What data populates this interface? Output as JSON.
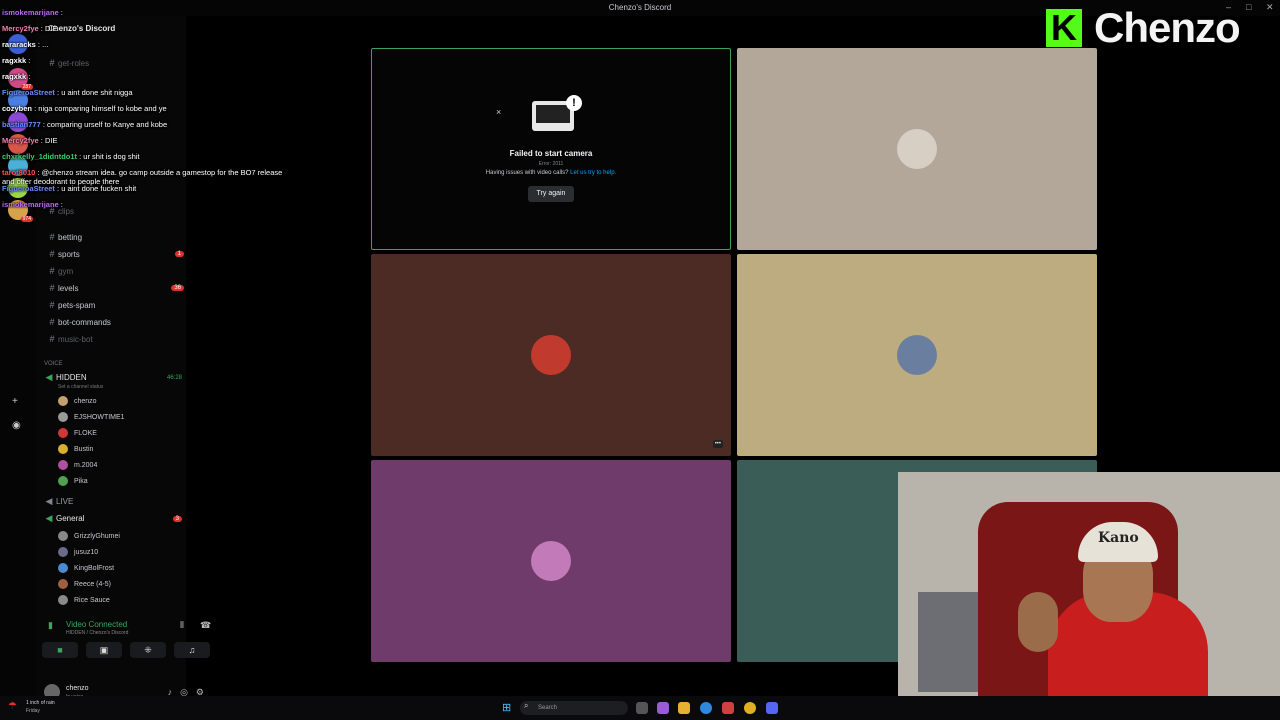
{
  "window": {
    "title": "Chenzo's Discord"
  },
  "brand": {
    "logo_letter": "K",
    "name": "Chenzo",
    "accent": "#53fc18"
  },
  "chat": [
    {
      "user": "ismokemarijane",
      "color": "#b86cf0",
      "text": ""
    },
    {
      "user": "Mercy2fye",
      "color": "#f47fb0",
      "text": "DIE"
    },
    {
      "user": "rararacks",
      "color": "#ffffff",
      "text": "..."
    },
    {
      "user": "ragxkk",
      "color": "#ffffff",
      "text": ""
    },
    {
      "user": "ragxkk",
      "color": "#ffffff",
      "text": ""
    },
    {
      "user": "FigueroaStreet",
      "color": "#6c8cff",
      "text": "u aint done shit nigga"
    },
    {
      "user": "cozyben",
      "color": "#ffffff",
      "text": "niga comparing himself to kobe and ye"
    },
    {
      "user": "bastian777",
      "color": "#6c8cff",
      "text": "comparing urself to Kanye and kobe"
    },
    {
      "user": "Mercy2fye",
      "color": "#f47fb0",
      "text": "DIE"
    },
    {
      "user": "chxrkelly_1didntdo1t",
      "color": "#3ccf6e",
      "text": "ur shit is dog shit"
    },
    {
      "user": "tarot8010",
      "color": "#ff5050",
      "text": "@chenzo stream idea. go camp outside a gamestop for the BO7 release and offer deodorant to people there"
    },
    {
      "user": "FigueroaStreet",
      "color": "#6c8cff",
      "text": "u aint done fucken shit"
    },
    {
      "user": "ismokemarijane",
      "color": "#b86cf0",
      "text": ""
    }
  ],
  "rail": {
    "servers": [
      {
        "color": "#3b5fd6",
        "badge": ""
      },
      {
        "color": "#d04a8a",
        "badge": "287"
      },
      {
        "color": "#4a7fe0",
        "badge": ""
      },
      {
        "color": "#8a4ad6",
        "badge": ""
      },
      {
        "color": "#d6574a",
        "badge": ""
      },
      {
        "color": "#4ab0d6",
        "badge": ""
      },
      {
        "color": "#9ad64a",
        "badge": ""
      },
      {
        "color": "#d6a24a",
        "badge": "974"
      }
    ]
  },
  "sidebar": {
    "server_name": "Chenzo's Discord",
    "channels_top": [
      {
        "name": "get-roles",
        "muted": true,
        "count": ""
      },
      {
        "name": "clips",
        "muted": true,
        "count": ""
      },
      {
        "name": "betting",
        "muted": false,
        "count": ""
      },
      {
        "name": "sports",
        "muted": false,
        "count": "1"
      },
      {
        "name": "gym",
        "muted": true,
        "count": ""
      },
      {
        "name": "levels",
        "muted": false,
        "count": "36"
      },
      {
        "name": "pets-spam",
        "muted": false,
        "count": ""
      },
      {
        "name": "bot-commands",
        "muted": false,
        "count": ""
      },
      {
        "name": "music-bot",
        "muted": true,
        "count": ""
      }
    ],
    "voice_category": "Voice",
    "voice_channel": {
      "name": "HIDDEN",
      "time": "46:28",
      "status": "Set a channel status"
    },
    "voice_members": [
      {
        "name": "chenzo",
        "color": "#c4a070"
      },
      {
        "name": "EJSHOWTIME1",
        "color": "#9a9a9a"
      },
      {
        "name": "FLOKE",
        "color": "#d03838"
      },
      {
        "name": "Bustin",
        "color": "#d8b030"
      },
      {
        "name": "m.2004",
        "color": "#b050a0"
      },
      {
        "name": "Pika",
        "color": "#50a050"
      }
    ],
    "live_label": "LIVE",
    "general": {
      "name": "General",
      "count": "3"
    },
    "general_members": [
      {
        "name": "GrizzlyGhumei",
        "color": "#888888"
      },
      {
        "name": "jusuz10",
        "color": "#6a6a8a"
      },
      {
        "name": "KingBolFrost",
        "color": "#4a8ad0"
      },
      {
        "name": "Reece (4-5)",
        "color": "#a06040"
      },
      {
        "name": "Rice Sauce",
        "color": "#8a8a8a"
      }
    ],
    "voice_panel": {
      "status": "Video Connected",
      "sub": "HIDDEN / Chenzo's Discord"
    },
    "user": {
      "name": "chenzo",
      "status": "In voice"
    }
  },
  "tiles": [
    {
      "bg": "#050506",
      "border": "#3ba55d",
      "avatar": "",
      "error": true
    },
    {
      "bg": "#b3a79a",
      "border": "",
      "avatar": "#d7cec4",
      "error": false
    },
    {
      "bg": "#4d2b25",
      "border": "",
      "avatar": "#c13a2e",
      "error": false
    },
    {
      "bg": "#bdac7f",
      "border": "",
      "avatar": "#6a7fa0",
      "error": false
    },
    {
      "bg": "#6e3b6a",
      "border": "",
      "avatar": "#c37ab8",
      "error": false
    },
    {
      "bg": "#3a5d58",
      "border": "",
      "avatar": "",
      "error": false
    }
  ],
  "camera_error": {
    "title": "Failed to start camera",
    "code": "Error: 2011",
    "help_text": "Having issues with video calls?",
    "help_link": "Let us try to help.",
    "retry_label": "Try again"
  },
  "webcam": {
    "cap_text": "Kano"
  },
  "taskbar": {
    "weather": "1 inch of rain",
    "day": "Friday",
    "search_placeholder": "Search"
  }
}
